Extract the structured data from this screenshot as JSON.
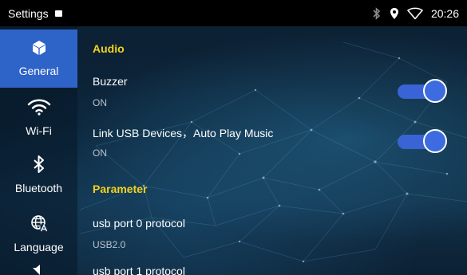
{
  "statusbar": {
    "title": "Settings",
    "time": "20:26"
  },
  "sidebar": {
    "items": [
      {
        "label": "General",
        "icon": "cube-icon",
        "active": true
      },
      {
        "label": "Wi-Fi",
        "icon": "wifi-icon",
        "active": false
      },
      {
        "label": "Bluetooth",
        "icon": "bluetooth-icon",
        "active": false
      },
      {
        "label": "Language",
        "icon": "globe-icon",
        "active": false
      }
    ]
  },
  "content": {
    "audio_header": "Audio",
    "buzzer": {
      "title": "Buzzer",
      "status": "ON",
      "enabled": true
    },
    "link_usb": {
      "title": "Link USB Devices，Auto Play Music",
      "status": "ON",
      "enabled": true
    },
    "parameter_header": "Parameter",
    "usb_port0": {
      "title": "usb port 0 protocol",
      "value": "USB2.0"
    },
    "usb_port1": {
      "title": "usb port 1 protocol"
    }
  },
  "colors": {
    "accent": "#2e63c8",
    "section_header": "#f2d21b",
    "toggle_on": "#3a63d6"
  }
}
